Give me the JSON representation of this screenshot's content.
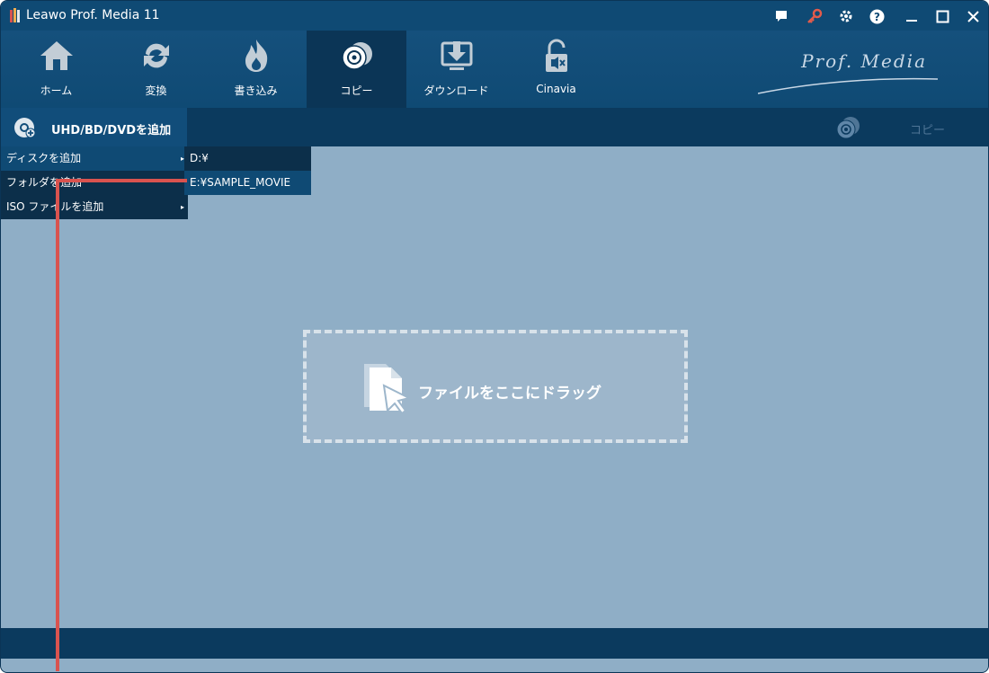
{
  "window": {
    "title": "Leawo Prof. Media 11",
    "controls": {
      "chat_icon": "chat-icon",
      "key_icon": "key-icon",
      "gear_icon": "gear-icon",
      "help_icon": "help-icon",
      "minimize_icon": "minimize-icon",
      "maximize_icon": "maximize-icon",
      "close_icon": "close-icon"
    }
  },
  "toolbar": {
    "items": [
      {
        "label": "ホーム",
        "icon": "home-icon"
      },
      {
        "label": "変換",
        "icon": "convert-icon"
      },
      {
        "label": "書き込み",
        "icon": "burn-icon"
      },
      {
        "label": "コピー",
        "icon": "copy-disc-icon",
        "active": true
      },
      {
        "label": "ダウンロード",
        "icon": "download-icon"
      },
      {
        "label": "Cinavia",
        "icon": "cinavia-icon"
      }
    ],
    "brand": "Prof. Media"
  },
  "subbar": {
    "add_button_label": "UHD/BD/DVDを追加",
    "copy_label": "コピー"
  },
  "menu": {
    "items": [
      {
        "label": "ディスクを追加",
        "has_submenu": true
      },
      {
        "label": "フォルダを追加",
        "has_submenu": false
      },
      {
        "label": "ISO ファイルを追加",
        "has_submenu": true
      }
    ],
    "arrow": "▸"
  },
  "submenu": {
    "items": [
      {
        "label": "D:¥"
      },
      {
        "label": "E:¥SAMPLE_MOVIE"
      }
    ]
  },
  "drop_zone": {
    "text": "ファイルをここにドラッグ"
  },
  "colors": {
    "titlebar": "#0f4a74",
    "content": "#8faec6",
    "callout": "#d9534f"
  }
}
